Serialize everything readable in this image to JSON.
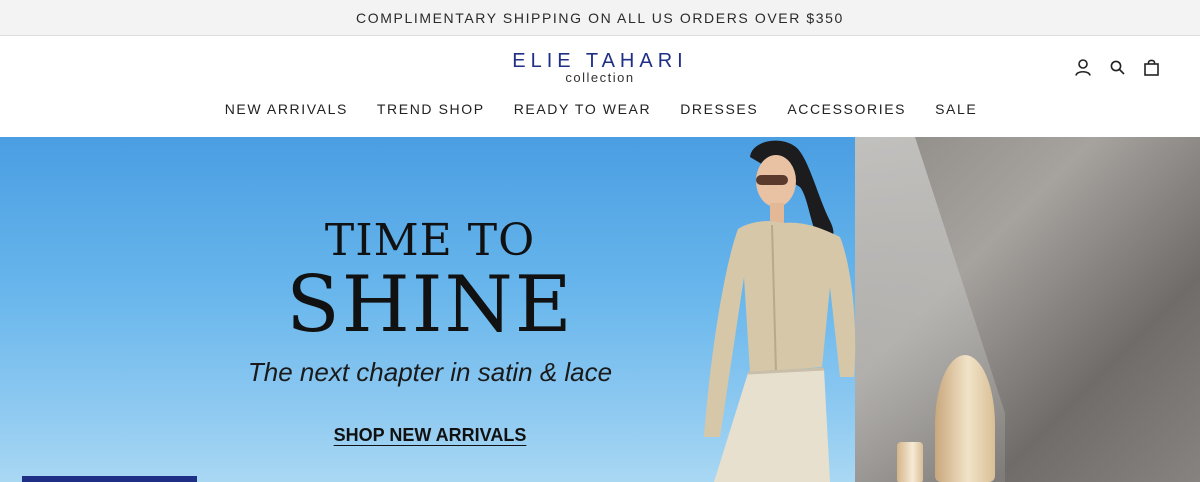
{
  "announcement": {
    "text": "COMPLIMENTARY SHIPPING ON ALL US ORDERS OVER $350"
  },
  "header": {
    "logo_main": "ELIE TAHARI",
    "logo_sub": "collection",
    "icons": [
      "account-icon",
      "search-icon",
      "bag-icon"
    ]
  },
  "nav": {
    "items": [
      "NEW ARRIVALS",
      "TREND SHOP",
      "READY TO WEAR",
      "DRESSES",
      "ACCESSORIES",
      "SALE"
    ]
  },
  "hero": {
    "title_line1": "TIME TO",
    "title_line2": "SHINE",
    "subtitle": "The next chapter in satin & lace",
    "cta": "SHOP NEW ARRIVALS"
  },
  "colors": {
    "brand": "#1f2f86",
    "announcement_bg": "#f3f3f3",
    "sky": "#68b6ec"
  }
}
